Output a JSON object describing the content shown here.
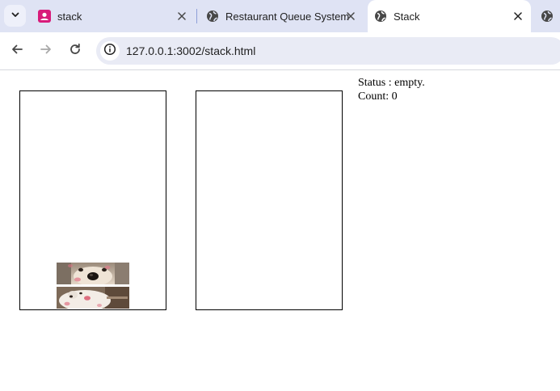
{
  "browser": {
    "tabs": [
      {
        "title": "stack",
        "icon": "profile-app-icon",
        "active": false
      },
      {
        "title": "Restaurant Queue System",
        "icon": "globe-icon",
        "active": false
      },
      {
        "title": "Stack",
        "icon": "globe-icon",
        "active": true
      }
    ],
    "address_bar": {
      "url": "127.0.0.1:3002/stack.html"
    }
  },
  "page": {
    "status": {
      "status_line": "Status : empty.",
      "count_line": "Count: 0"
    },
    "stacks": [
      {
        "name": "left-stack",
        "items": [
          "puppy-face-image",
          "puppy-lying-image"
        ]
      },
      {
        "name": "right-stack",
        "items": []
      }
    ]
  },
  "colors": {
    "tabbar_bg": "#dfe3f4",
    "active_tab_bg": "#ffffff",
    "omnibox_bg": "#e9ebf5",
    "profile_icon": "#d81b7a"
  }
}
